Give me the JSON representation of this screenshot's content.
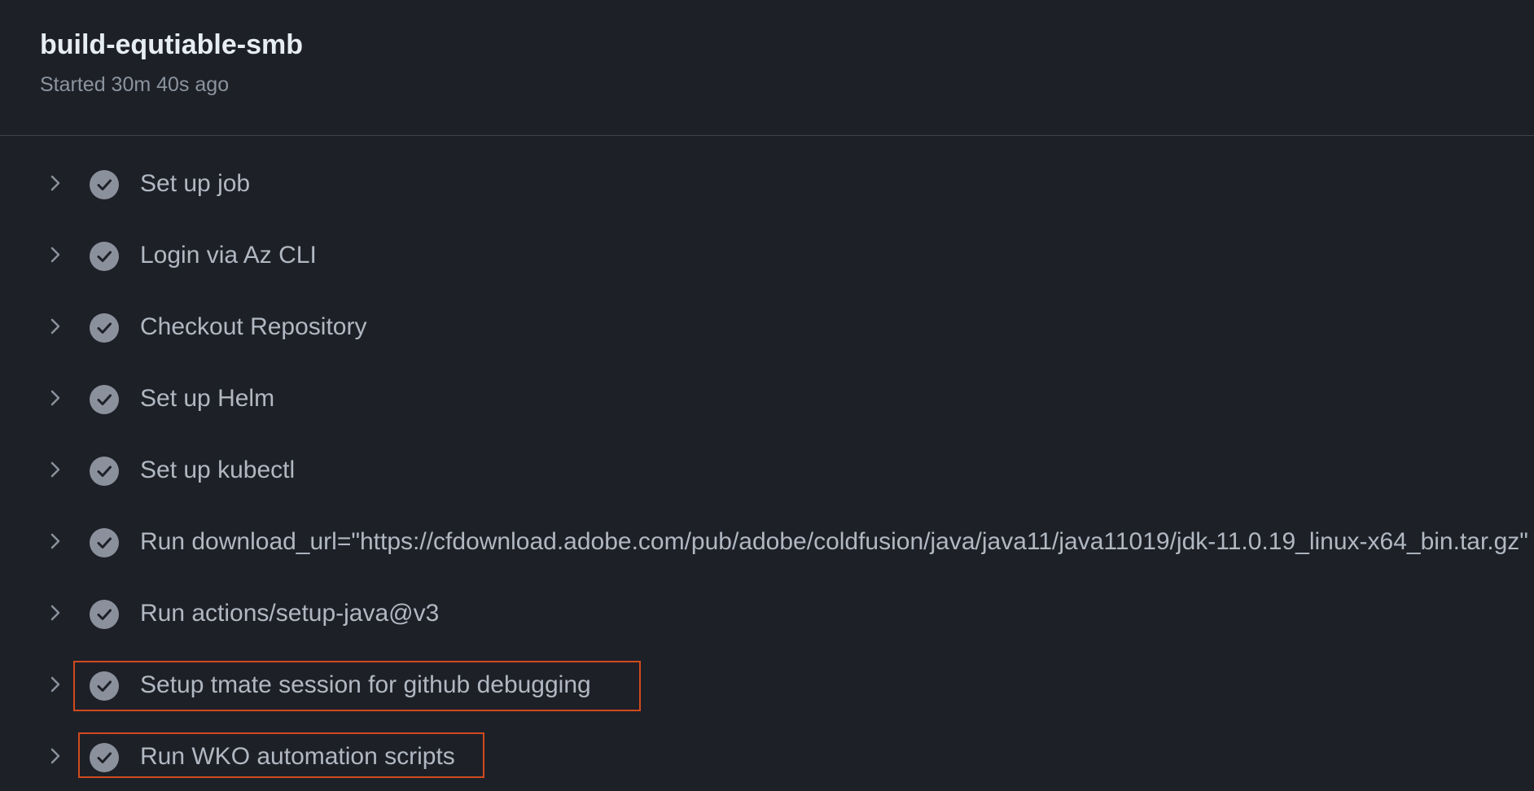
{
  "job": {
    "title": "build-equtiable-smb",
    "started": "Started 30m 40s ago"
  },
  "steps": [
    {
      "label": "Set up job",
      "status": "success",
      "icon": "check-circle-icon"
    },
    {
      "label": "Login via Az CLI",
      "status": "success",
      "icon": "check-circle-icon"
    },
    {
      "label": "Checkout Repository",
      "status": "success",
      "icon": "check-circle-icon"
    },
    {
      "label": "Set up Helm",
      "status": "success",
      "icon": "check-circle-icon"
    },
    {
      "label": "Set up kubectl",
      "status": "success",
      "icon": "check-circle-icon"
    },
    {
      "label": "Run download_url=\"https://cfdownload.adobe.com/pub/adobe/coldfusion/java/java11/java11019/jdk-11.0.19_linux-x64_bin.tar.gz\"",
      "status": "success",
      "icon": "check-circle-icon"
    },
    {
      "label": "Run actions/setup-java@v3",
      "status": "success",
      "icon": "check-circle-icon"
    },
    {
      "label": "Setup tmate session for github debugging",
      "status": "success",
      "icon": "check-circle-icon",
      "highlighted": true
    },
    {
      "label": "Run WKO automation scripts",
      "status": "success",
      "icon": "check-circle-icon",
      "highlighted": true
    }
  ],
  "colors": {
    "background": "#1e2028",
    "title": "#e6edf3",
    "muted": "#8b949e",
    "step_text": "#b1b8c2",
    "check_circle": "#8b919c",
    "highlight": "#d04a1e"
  }
}
